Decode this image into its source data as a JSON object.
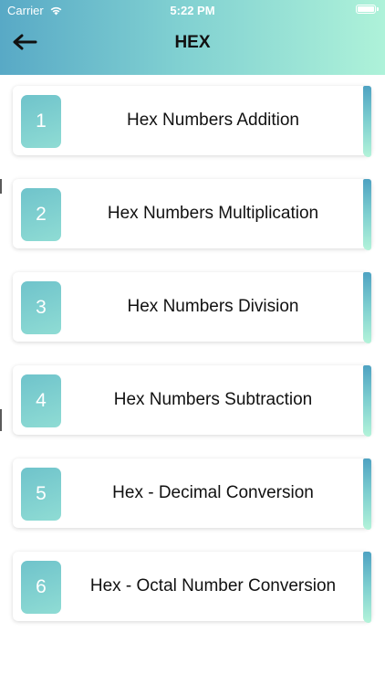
{
  "status_bar": {
    "carrier": "Carrier",
    "time": "5:22 PM",
    "wifi_icon": "wifi-icon",
    "battery_icon": "battery-icon"
  },
  "header": {
    "title": "HEX",
    "back_icon": "arrow-left-icon"
  },
  "colors": {
    "header_gradient_start": "#58a9c6",
    "header_gradient_end": "#aef2d9",
    "badge": "#7fcfcf",
    "accent_strip": "#4ea2c2"
  },
  "items": [
    {
      "number": "1",
      "label": "Hex Numbers Addition"
    },
    {
      "number": "2",
      "label": "Hex Numbers Multiplication"
    },
    {
      "number": "3",
      "label": "Hex Numbers Division"
    },
    {
      "number": "4",
      "label": "Hex Numbers Subtraction"
    },
    {
      "number": "5",
      "label": "Hex - Decimal Conversion"
    },
    {
      "number": "6",
      "label": "Hex - Octal Number Conversion"
    }
  ]
}
